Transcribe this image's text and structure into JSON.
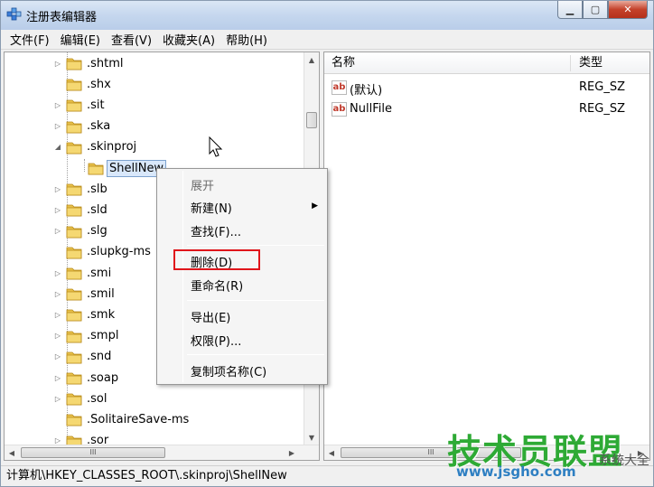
{
  "window": {
    "title": "注册表编辑器",
    "minimize_label": "▁",
    "maximize_label": "▢",
    "close_label": "✕"
  },
  "menubar": [
    "文件(F)",
    "编辑(E)",
    "查看(V)",
    "收藏夹(A)",
    "帮助(H)"
  ],
  "tree": {
    "items": [
      {
        "label": ".shtml",
        "expander": "▷"
      },
      {
        "label": ".shx",
        "expander": ""
      },
      {
        "label": ".sit",
        "expander": "▷"
      },
      {
        "label": ".ska",
        "expander": "▷"
      },
      {
        "label": ".skinproj",
        "expander": "◢"
      },
      {
        "label": "ShellNew",
        "expander": "",
        "selected": true
      },
      {
        "label": ".slb",
        "expander": "▷"
      },
      {
        "label": ".sld",
        "expander": "▷"
      },
      {
        "label": ".slg",
        "expander": "▷"
      },
      {
        "label": ".slupkg-ms",
        "expander": ""
      },
      {
        "label": ".smi",
        "expander": "▷"
      },
      {
        "label": ".smil",
        "expander": "▷"
      },
      {
        "label": ".smk",
        "expander": "▷"
      },
      {
        "label": ".smpl",
        "expander": "▷"
      },
      {
        "label": ".snd",
        "expander": "▷"
      },
      {
        "label": ".soap",
        "expander": "▷"
      },
      {
        "label": ".sol",
        "expander": "▷"
      },
      {
        "label": ".SolitaireSave-ms",
        "expander": ""
      },
      {
        "label": ".sor",
        "expander": "▷"
      }
    ],
    "hscroll_label": "III"
  },
  "list": {
    "headers": {
      "name": "名称",
      "type": "类型"
    },
    "rows": [
      {
        "icon": "ab",
        "name": "(默认)",
        "type": "REG_SZ"
      },
      {
        "icon": "ab",
        "name": "NullFile",
        "type": "REG_SZ"
      }
    ],
    "hscroll_label": "III"
  },
  "context_menu": {
    "items": [
      {
        "label": "展开",
        "disabled": true
      },
      {
        "label": "新建(N)",
        "submenu": true
      },
      {
        "label": "查找(F)..."
      },
      {
        "label": "删除(D)",
        "highlighted": true
      },
      {
        "label": "重命名(R)"
      },
      {
        "label": "导出(E)"
      },
      {
        "label": "权限(P)..."
      },
      {
        "label": "复制项名称(C)"
      }
    ],
    "submenu_arrow": "▶"
  },
  "statusbar": {
    "path": "计算机\\HKEY_CLASSES_ROOT\\.skinproj\\ShellNew"
  },
  "watermark": {
    "title": "技术员联盟",
    "sub": "系统大全",
    "url": "www.jsgho.com"
  },
  "colors": {
    "highlight_box": "#e0151b",
    "watermark_green": "#2eaa35",
    "selected_bg": "#d9e8fb"
  }
}
